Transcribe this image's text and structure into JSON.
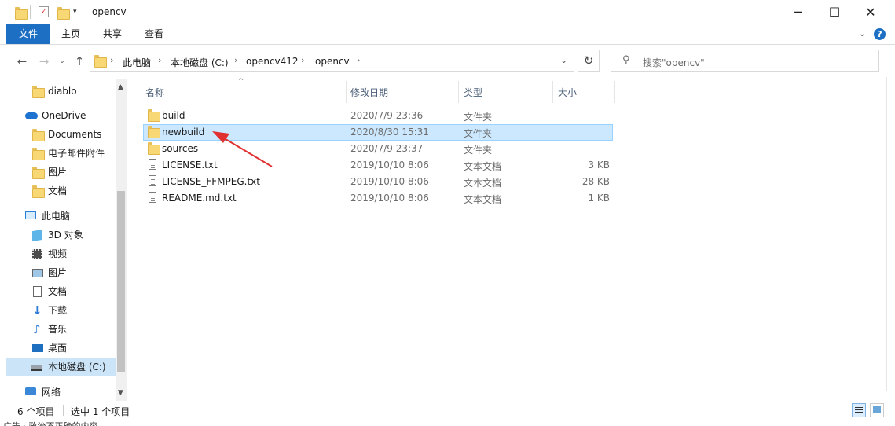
{
  "window": {
    "title": "opencv",
    "controls": {
      "minimize": "─",
      "maximize": "☐",
      "close": "✕"
    }
  },
  "ribbon": {
    "tabs": [
      {
        "label": "文件",
        "active": true
      },
      {
        "label": "主页"
      },
      {
        "label": "共享"
      },
      {
        "label": "查看"
      }
    ],
    "help": "?"
  },
  "address": {
    "crumbs": [
      "此电脑",
      "本地磁盘 (C:)",
      "opencv412",
      "opencv"
    ]
  },
  "search": {
    "placeholder": "搜索\"opencv\""
  },
  "nav": {
    "items": [
      {
        "label": "diablo",
        "icon": "folder-icon"
      },
      {
        "label": "OneDrive",
        "icon": "cloud-icon"
      },
      {
        "label": "Documents",
        "icon": "folder-icon"
      },
      {
        "label": "电子邮件附件",
        "icon": "folder-icon"
      },
      {
        "label": "图片",
        "icon": "folder-icon"
      },
      {
        "label": "文档",
        "icon": "folder-icon"
      },
      {
        "label": "此电脑",
        "icon": "computer-icon"
      },
      {
        "label": "3D 对象",
        "icon": "cube-icon"
      },
      {
        "label": "视频",
        "icon": "video-icon"
      },
      {
        "label": "图片",
        "icon": "picture-icon"
      },
      {
        "label": "文档",
        "icon": "document-icon"
      },
      {
        "label": "下载",
        "icon": "download-icon"
      },
      {
        "label": "音乐",
        "icon": "music-icon"
      },
      {
        "label": "桌面",
        "icon": "desktop-icon"
      },
      {
        "label": "本地磁盘 (C:)",
        "icon": "drive-icon",
        "selected": true
      },
      {
        "label": "网络",
        "icon": "network-icon"
      }
    ]
  },
  "columns": {
    "name": "名称",
    "date": "修改日期",
    "type": "类型",
    "size": "大小"
  },
  "files": [
    {
      "name": "build",
      "date": "2020/7/9 23:36",
      "type": "文件夹",
      "size": "",
      "kind": "folder"
    },
    {
      "name": "newbuild",
      "date": "2020/8/30 15:31",
      "type": "文件夹",
      "size": "",
      "kind": "folder",
      "selected": true
    },
    {
      "name": "sources",
      "date": "2020/7/9 23:37",
      "type": "文件夹",
      "size": "",
      "kind": "folder"
    },
    {
      "name": "LICENSE.txt",
      "date": "2019/10/10 8:06",
      "type": "文本文档",
      "size": "3 KB",
      "kind": "text"
    },
    {
      "name": "LICENSE_FFMPEG.txt",
      "date": "2019/10/10 8:06",
      "type": "文本文档",
      "size": "28 KB",
      "kind": "text"
    },
    {
      "name": "README.md.txt",
      "date": "2019/10/10 8:06",
      "type": "文本文档",
      "size": "1 KB",
      "kind": "text"
    }
  ],
  "status": {
    "count": "6 个项目",
    "selected": "选中 1 个项目"
  },
  "bottom_caption": "广告 · 政治不正确的内容",
  "colors": {
    "accent": "#1c6fc2",
    "selected_row": "#cce8ff",
    "nav_selected": "#cce4f7",
    "arrow": "#e03030"
  }
}
